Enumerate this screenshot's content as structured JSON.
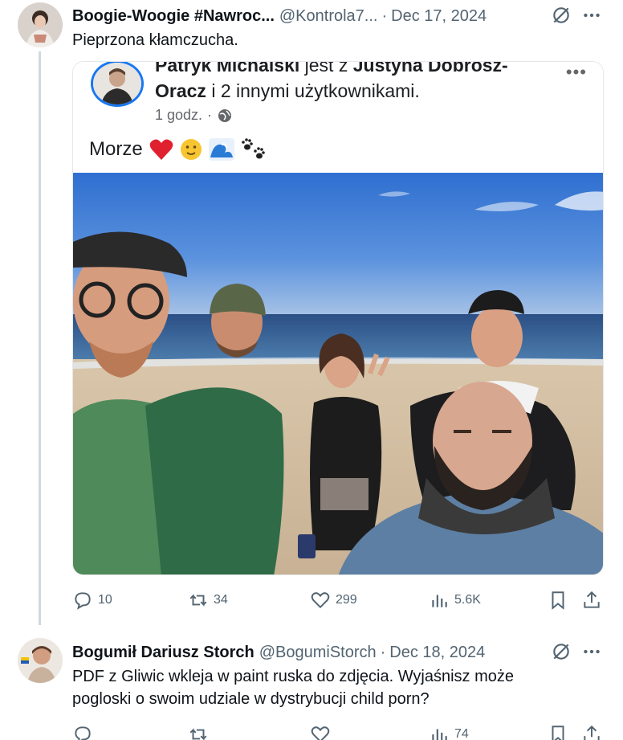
{
  "tweet1": {
    "display_name": "Boogie-Woogie #Nawroc...",
    "handle": "@Kontrola7...",
    "separator": "·",
    "date": "Dec 17, 2024",
    "text": "Pieprzona kłamczucha.",
    "embed": {
      "title_line1_prefix": "Patryk Michalski",
      "title_line1_mid": " jest z ",
      "title_line1_name": "Justyna Dobrosz-",
      "title_line2_name": "Oracz",
      "title_line2_rest": " i 2 innymi użytkownikami.",
      "meta_time": "1 godz.",
      "meta_separator": "·",
      "more": "•••",
      "post_text": "Morze",
      "emojis": [
        "heart",
        "smiling-face",
        "wave",
        "paw-prints"
      ]
    },
    "actions": {
      "replies": "10",
      "reposts": "34",
      "likes": "299",
      "views": "5.6K"
    }
  },
  "tweet2": {
    "display_name": "Bogumił Dariusz Storch",
    "handle": "@BogumiStorch",
    "separator": "·",
    "date": "Dec 18, 2024",
    "text_line1": "PDF z Gliwic wkleja w paint ruska do zdjęcia. Wyjaśnisz może",
    "text_line2": "pogloski o swoim udziale w dystrybucji child porn?",
    "actions": {
      "replies": "",
      "reposts": "",
      "likes": "",
      "views": "74"
    }
  },
  "colors": {
    "text_primary": "#0f1419",
    "text_secondary": "#536471",
    "thread_line": "#cfd9de",
    "fb_blue": "#1877f2"
  }
}
